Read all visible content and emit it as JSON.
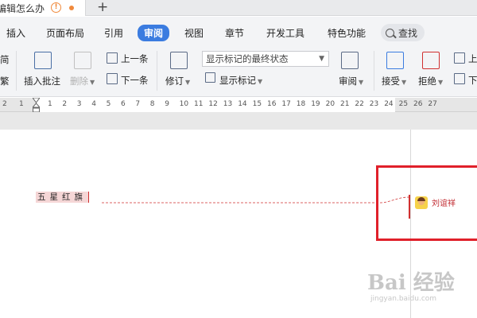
{
  "tabstrip": {
    "doc_title": "编辑怎么办",
    "warn_icon": "alert-circle-icon",
    "new_tab_glyph": "+"
  },
  "ribbon_tabs": [
    {
      "label": "插入"
    },
    {
      "label": "页面布局"
    },
    {
      "label": "引用"
    },
    {
      "label": "审阅",
      "active": true
    },
    {
      "label": "视图"
    },
    {
      "label": "章节"
    },
    {
      "label": "开发工具"
    },
    {
      "label": "特色功能"
    }
  ],
  "search": {
    "label": "查找"
  },
  "toolbar": {
    "left_cut_top": "简",
    "left_cut_bottom": "繁",
    "insert_comment": "插入批注",
    "delete": "删除",
    "prev_item": "上一条",
    "next_item": "下一条",
    "revise": "修订",
    "markup_select": "显示标记的最终状态",
    "show_markup": "显示标记",
    "review_pane": "审阅",
    "accept": "接受",
    "reject": "拒绝",
    "prev_cut": "上",
    "next_cut": "下"
  },
  "ruler": {
    "labels_left": [
      "2",
      "1"
    ],
    "labels": [
      "1",
      "2",
      "3",
      "4",
      "5",
      "6",
      "7",
      "8",
      "9",
      "10",
      "11",
      "12",
      "13",
      "14",
      "15",
      "16",
      "17",
      "18",
      "19",
      "20",
      "21",
      "22"
    ],
    "labels_right": [
      "23",
      "24",
      "25",
      "26",
      "27"
    ]
  },
  "document": {
    "marked_text": "五星红旗"
  },
  "comment": {
    "author": "刘谊祥",
    "accent_color": "#e0202a"
  },
  "watermark": {
    "logo_text": "Bai 经验",
    "url": "jingyan.baidu.com"
  },
  "colors": {
    "active_tab": "#3b7ce0",
    "ribbon_bg": "#f3f4f6",
    "markup_red": "#d03030"
  }
}
